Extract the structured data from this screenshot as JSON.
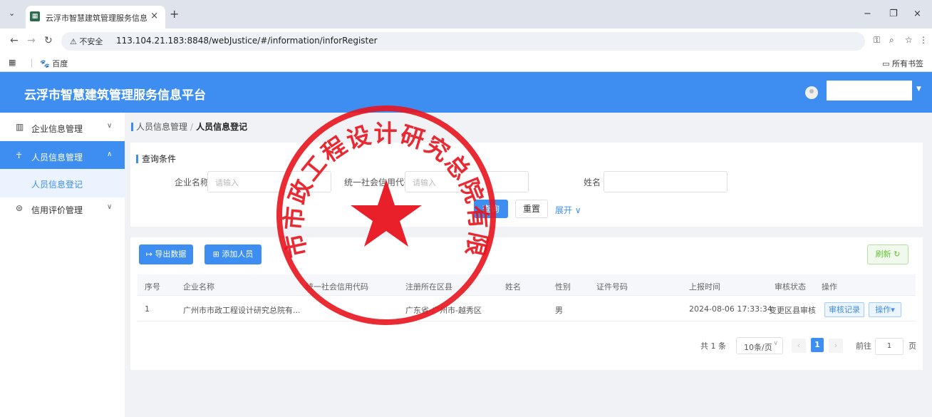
{
  "browser": {
    "tab_title": "云浮市智慧建筑管理服务信息平",
    "tab_close": "×",
    "new_tab": "+",
    "security_label": "不安全",
    "url": "113.104.21.183:8848/webJustice/#/information/inforRegister",
    "bookmark_baidu": "百度",
    "bookmark_all": "所有书签",
    "window_minimize": "−",
    "window_restore": "❐",
    "window_close": "×"
  },
  "app": {
    "title": "云浮市智慧建筑管理服务信息平台"
  },
  "sidebar": {
    "items": [
      {
        "label": "企业信息管理",
        "icon": "building-icon"
      },
      {
        "label": "人员信息管理",
        "icon": "user-group-icon"
      },
      {
        "label": "信用评价管理",
        "icon": "credit-icon"
      }
    ],
    "sub_item": "人员信息登记"
  },
  "breadcrumb": {
    "parent": "人员信息管理",
    "separator": "/",
    "current": "人员信息登记"
  },
  "query": {
    "title": "查询条件",
    "company_label": "企业名称",
    "company_placeholder": "请输入",
    "credit_label": "统一社会信用代码",
    "credit_placeholder": "请输入",
    "name_label": "姓名",
    "search_button": "查询",
    "reset_button": "重置",
    "expand_label": "展开"
  },
  "toolbar": {
    "export_button": "导出数据",
    "add_button": "添加人员",
    "refresh_button": "刷新"
  },
  "table": {
    "headers": [
      "序号",
      "企业名称",
      "统一社会信用代码",
      "注册所在区县",
      "姓名",
      "性别",
      "证件号码",
      "上报时间",
      "审核状态",
      "操作"
    ],
    "rows": [
      {
        "index": "1",
        "company": "广州市市政工程设计研究总院有...",
        "credit_code": "",
        "district": "广东省-广州市-越秀区",
        "name": "",
        "gender": "男",
        "id_number": "",
        "report_time": "2024-08-06 17:33:34",
        "status": "变更区县审核",
        "action_records": "审核记录",
        "action_ops": "操作"
      }
    ]
  },
  "pagination": {
    "total": "共 1 条",
    "page_size": "10条/页",
    "current_page": "1",
    "goto_label": "前往",
    "goto_value": "1",
    "page_suffix": "页"
  },
  "stamp": {
    "ring_text": "广州市市政工程设计研究总院有限公司",
    "color": "#e8141e"
  },
  "colors": {
    "primary": "#3d8ef0",
    "success": "#67c23a"
  }
}
